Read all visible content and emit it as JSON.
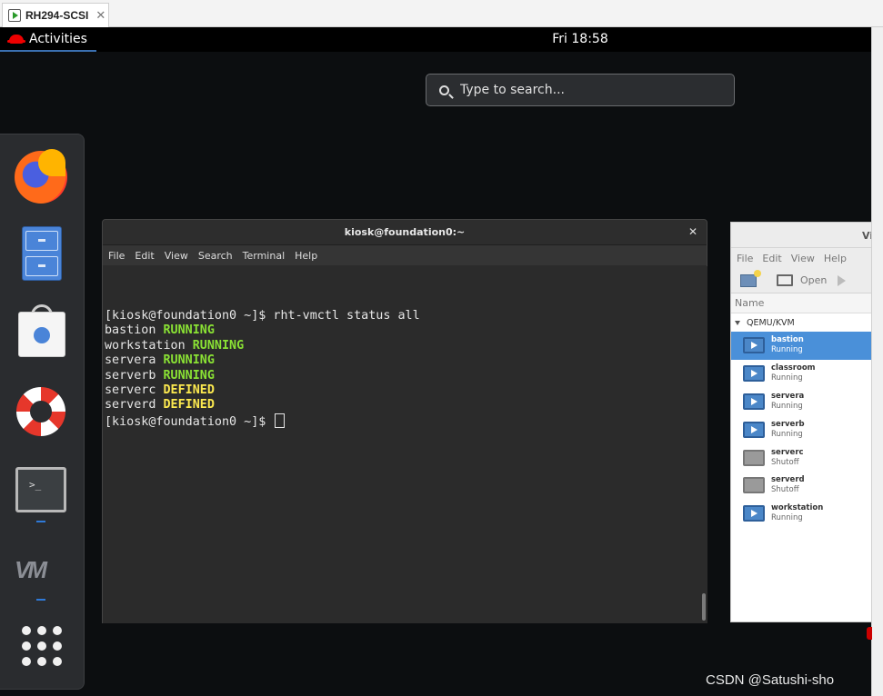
{
  "host": {
    "tab_label": "RH294-SCSI",
    "tab_close": "✕"
  },
  "topbar": {
    "activities_label": "Activities",
    "clock": "Fri 18:58"
  },
  "search": {
    "placeholder": "Type to search..."
  },
  "dash": {
    "items": [
      "firefox-icon",
      "files-icon",
      "software-icon",
      "help-icon",
      "terminal-icon",
      "virt-manager-icon",
      "show-applications-icon"
    ],
    "terminal_prompt": ">_"
  },
  "terminal": {
    "title": "kiosk@foundation0:~",
    "close": "✕",
    "menu": [
      "File",
      "Edit",
      "View",
      "Search",
      "Terminal",
      "Help"
    ],
    "command_prompt": "[kiosk@foundation0 ~]$ rht-vmctl status all",
    "final_prompt": "[kiosk@foundation0 ~]$ ",
    "status_lines": [
      {
        "host": "bastion",
        "status": "RUNNING"
      },
      {
        "host": "workstation",
        "status": "RUNNING"
      },
      {
        "host": "servera",
        "status": "RUNNING"
      },
      {
        "host": "serverb",
        "status": "RUNNING"
      },
      {
        "host": "serverc",
        "status": "DEFINED"
      },
      {
        "host": "serverd",
        "status": "DEFINED"
      }
    ],
    "colors": {
      "running": "#8ae234",
      "defined": "#fce94f"
    }
  },
  "virt_manager": {
    "title_partial": "Vi",
    "menu": [
      "File",
      "Edit",
      "View",
      "Help"
    ],
    "open_label": "Open",
    "column_name": "Name",
    "group": "QEMU/KVM",
    "vms": [
      {
        "name": "bastion",
        "state": "Running"
      },
      {
        "name": "classroom",
        "state": "Running"
      },
      {
        "name": "servera",
        "state": "Running"
      },
      {
        "name": "serverb",
        "state": "Running"
      },
      {
        "name": "serverc",
        "state": "Shutoff"
      },
      {
        "name": "serverd",
        "state": "Shutoff"
      },
      {
        "name": "workstation",
        "state": "Running"
      }
    ],
    "selected_color": "#4a90d9"
  },
  "watermark": "CSDN @Satushi-sho"
}
